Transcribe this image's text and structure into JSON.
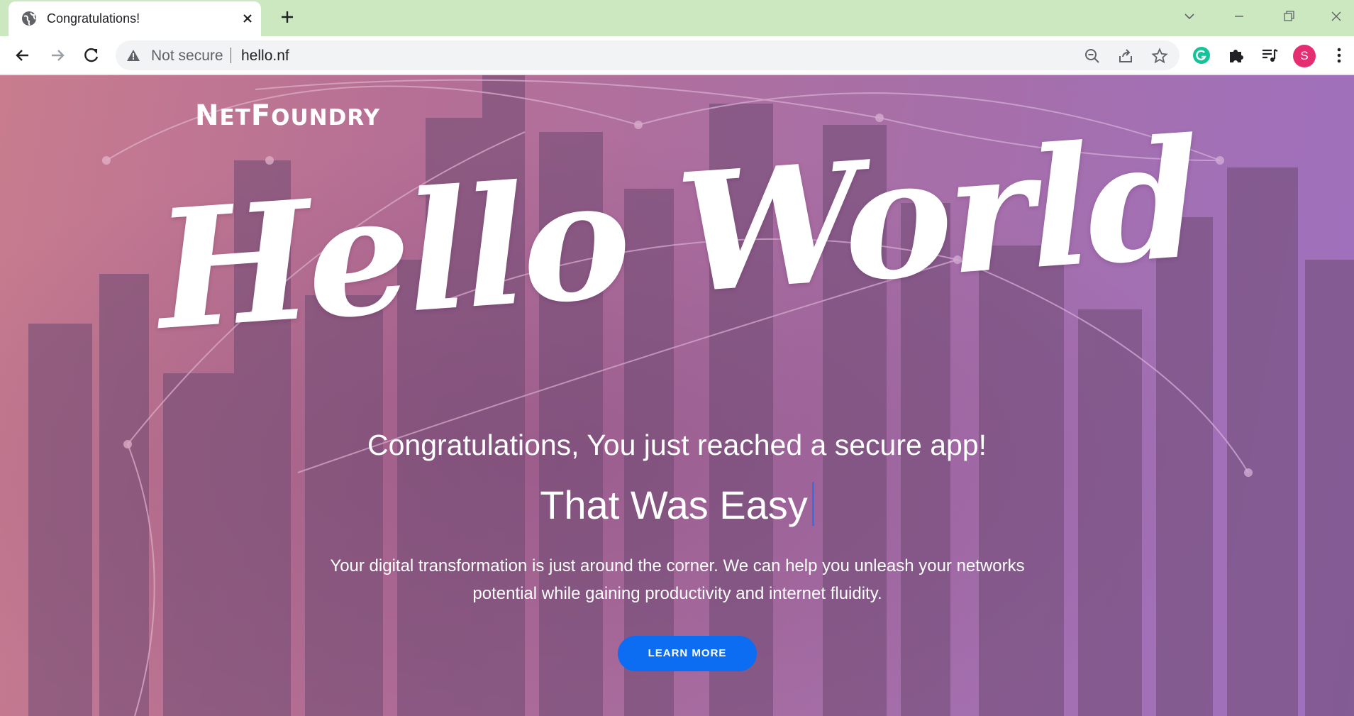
{
  "browser": {
    "tab": {
      "title": "Congratulations!",
      "favicon": "globe-icon"
    },
    "omnibox": {
      "security_label": "Not secure",
      "url": "hello.nf"
    },
    "profile_initial": "S"
  },
  "page": {
    "logo_first": "N",
    "logo_first_rest": "ET",
    "logo_second": "F",
    "logo_second_rest": "OUNDRY",
    "headline": "Hello World",
    "congrats": "Congratulations, You just reached a secure app!",
    "tagline": "That Was Easy",
    "body": "Your digital transformation is just around the corner. We can help you unleash your networks potential while gaining productivity and internet fluidity.",
    "cta_label": "LEARN MORE"
  },
  "colors": {
    "tab_strip": "#cbe8c1",
    "cta": "#0c6cf2",
    "profile": "#e52e71",
    "grammarly": "#15c39a"
  }
}
